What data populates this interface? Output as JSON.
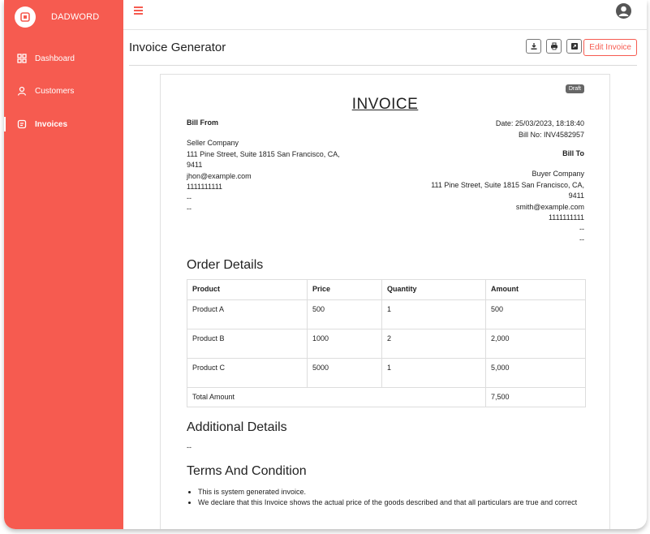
{
  "app": {
    "name": "DADWORD"
  },
  "sidebar": {
    "items": [
      {
        "label": "Dashboard",
        "icon": "dashboard-icon"
      },
      {
        "label": "Customers",
        "icon": "user-icon"
      },
      {
        "label": "Invoices",
        "icon": "invoice-icon",
        "active": true
      }
    ]
  },
  "header": {
    "title": "Invoice Generator",
    "edit_label": "Edit Invoice",
    "tools": [
      "download-icon",
      "print-icon",
      "external-link-icon"
    ]
  },
  "invoice": {
    "status_badge": "Draft",
    "title": "INVOICE",
    "bill_from_heading": "Bill From",
    "bill_from": [
      "Seller Company",
      "111 Pine Street, Suite 1815 San Francisco, CA, 9411",
      "jhon@example.com",
      "1111111111",
      "--",
      "--"
    ],
    "date": "Date: 25/03/2023, 18:18:40",
    "bill_no": "Bill No: INV4582957",
    "bill_to_heading": "Bill To",
    "bill_to": [
      "Buyer Company",
      "111 Pine Street, Suite 1815 San Francisco, CA, 9411",
      "smith@example.com",
      "1111111111",
      "--",
      "--"
    ],
    "order_heading": "Order Details",
    "columns": [
      "Product",
      "Price",
      "Quantity",
      "Amount"
    ],
    "rows": [
      [
        "Product A",
        "500",
        "1",
        "500"
      ],
      [
        "Product B",
        "1000",
        "2",
        "2,000"
      ],
      [
        "Product C",
        "5000",
        "1",
        "5,000"
      ]
    ],
    "total_label": "Total Amount",
    "total_value": "7,500",
    "additional_heading": "Additional Details",
    "additional_text": "--",
    "terms_heading": "Terms And Condition",
    "terms": [
      "This is system generated invoice.",
      "We declare that this Invoice shows the actual price of the goods described and that all particulars are true and correct"
    ]
  },
  "colors": {
    "accent": "#f65b50"
  }
}
